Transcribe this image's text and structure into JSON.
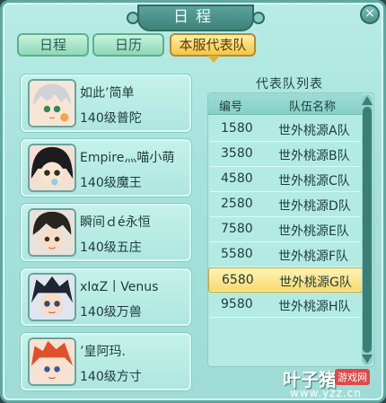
{
  "window": {
    "title": "日程",
    "close_label": "×"
  },
  "tabs": [
    {
      "label": "日程",
      "active": false
    },
    {
      "label": "日历",
      "active": false
    },
    {
      "label": "本服代表队",
      "active": true
    }
  ],
  "members": [
    {
      "name": "如此’简单",
      "level": "140级普陀",
      "avatar": "avatar-silver-hair"
    },
    {
      "name": "Empire灬喵小萌",
      "level": "140级魔王",
      "avatar": "avatar-black-hair"
    },
    {
      "name": "瞬间ｄé永恒",
      "level": "140级五庄",
      "avatar": "avatar-dark-hair"
    },
    {
      "name": "xIαZ丨Venus",
      "level": "140级万兽",
      "avatar": "avatar-spiky-hair"
    },
    {
      "name": "’皇阿玛.",
      "level": "140级方寸",
      "avatar": "avatar-red-hair"
    }
  ],
  "team_list": {
    "title": "代表队列表",
    "col_id": "编号",
    "col_name": "队伍名称",
    "rows": [
      {
        "id": "1580",
        "name": "世外桃源A队",
        "selected": false
      },
      {
        "id": "3580",
        "name": "世外桃源B队",
        "selected": false
      },
      {
        "id": "4580",
        "name": "世外桃源C队",
        "selected": false
      },
      {
        "id": "2580",
        "name": "世外桃源D队",
        "selected": false
      },
      {
        "id": "7580",
        "name": "世外桃源E队",
        "selected": false
      },
      {
        "id": "5580",
        "name": "世外桃源F队",
        "selected": false
      },
      {
        "id": "6580",
        "name": "世外桃源G队",
        "selected": true
      },
      {
        "id": "9580",
        "name": "世外桃源H队",
        "selected": false
      }
    ]
  },
  "watermark": {
    "name": "叶子猪",
    "tag": "游戏网",
    "url": "www.yzz.cn"
  },
  "colors": {
    "accent": "#f5c545",
    "panel": "#a6e2dc",
    "frame": "#5fa7a0"
  }
}
